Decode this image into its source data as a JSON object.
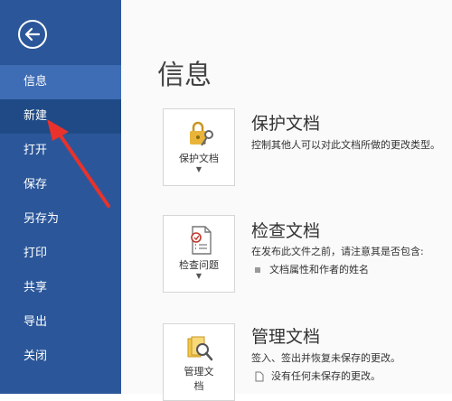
{
  "sidebar": {
    "items": [
      {
        "label": "信息"
      },
      {
        "label": "新建"
      },
      {
        "label": "打开"
      },
      {
        "label": "保存"
      },
      {
        "label": "另存为"
      },
      {
        "label": "打印"
      },
      {
        "label": "共享"
      },
      {
        "label": "导出"
      },
      {
        "label": "关闭"
      }
    ]
  },
  "main": {
    "title": "信息",
    "sections": [
      {
        "button_label": "保护文档",
        "title": "保护文档",
        "description": "控制其他人可以对此文档所做的更改类型。"
      },
      {
        "button_label": "检查问题",
        "title": "检查文档",
        "description": "在发布此文件之前，请注意其是否包含:",
        "bullet": "文档属性和作者的姓名"
      },
      {
        "button_label_line1": "管理文",
        "button_label_line2": "档",
        "title": "管理文档",
        "description": "签入、签出并恢复未保存的更改。",
        "bullet": "没有任何未保存的更改。"
      }
    ]
  },
  "colors": {
    "sidebar_bg": "#2b579a",
    "sidebar_active": "#3e6db5",
    "annotation_arrow": "#e8322b"
  }
}
